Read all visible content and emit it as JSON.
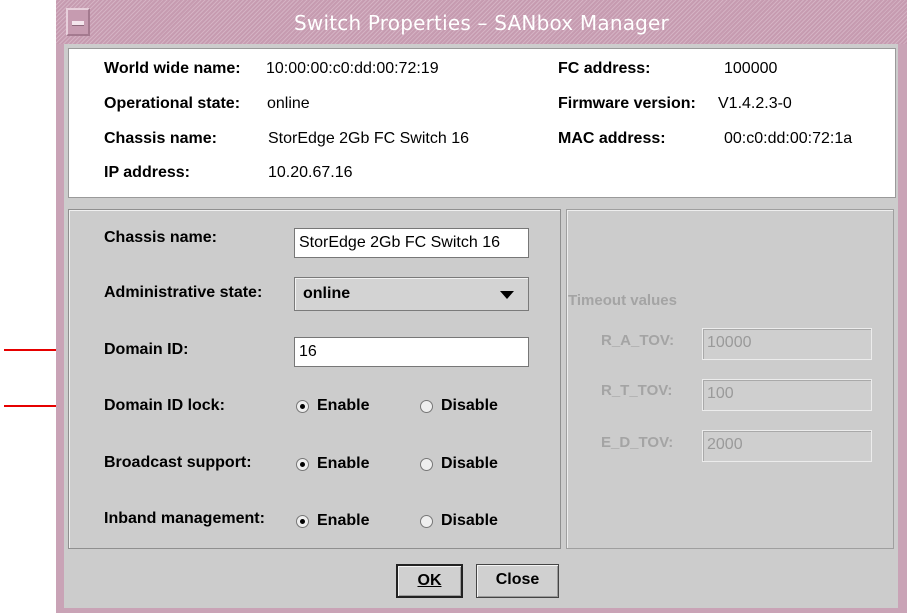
{
  "window": {
    "title": "Switch Properties – SANbox Manager"
  },
  "info": {
    "wwn_label": "World wide name:",
    "wwn_value": "10:00:00:c0:dd:00:72:19",
    "fc_label": "FC address:",
    "fc_value": "100000",
    "opstate_label": "Operational state:",
    "opstate_value": "online",
    "firmware_label": "Firmware version:",
    "firmware_value": "V1.4.2.3-0",
    "chassis_label": "Chassis name:",
    "chassis_value": "StorEdge 2Gb FC Switch 16",
    "mac_label": "MAC address:",
    "mac_value": "00:c0:dd:00:72:1a",
    "ip_label": "IP address:",
    "ip_value": "10.20.67.16"
  },
  "settings": {
    "chassis_label": "Chassis name:",
    "chassis_input": "StorEdge 2Gb FC Switch 16",
    "admin_label": "Administrative state:",
    "admin_value": "online",
    "domain_label": "Domain ID:",
    "domain_input": "16",
    "domain_lock_label": "Domain ID lock:",
    "broadcast_label": "Broadcast support:",
    "inband_label": "Inband management:",
    "enable_label": "Enable",
    "disable_label": "Disable",
    "domain_lock_selected": "Enable",
    "broadcast_selected": "Enable",
    "inband_selected": "Enable"
  },
  "timeouts": {
    "title": "Timeout values",
    "ra_label": "R_A_TOV:",
    "ra_value": "10000",
    "rt_label": "R_T_TOV:",
    "rt_value": "100",
    "ed_label": "E_D_TOV:",
    "ed_value": "2000"
  },
  "buttons": {
    "ok": "OK",
    "close": "Close"
  },
  "colors": {
    "titlebar": "#c69bb0",
    "arrow": "#e60000",
    "panel_bg": "#cccccc"
  },
  "icons": {
    "window_menu": "window-menu-icon",
    "dropdown": "chevron-down-icon",
    "annotation": "red-arrow"
  }
}
